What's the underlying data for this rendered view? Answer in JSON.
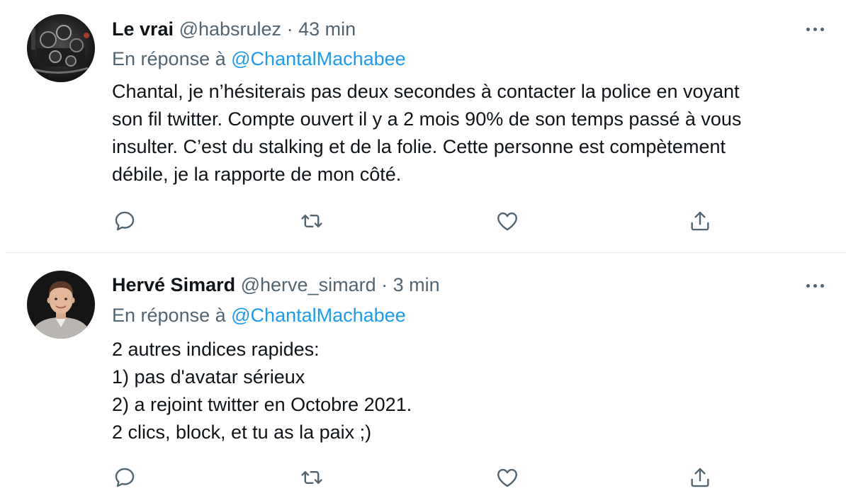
{
  "tweets": [
    {
      "name": "Le vrai",
      "handle": "@habsrulez",
      "separator": "·",
      "time": "43 min",
      "reply_prefix": "En réponse à",
      "reply_mention": "@ChantalMachabee",
      "body_lines": [
        "Chantal, je n’hésiterais pas deux secondes à contacter la police en voyant",
        "son fil twitter. Compte ouvert il y a 2 mois 90% de son temps passé à vous",
        "insulter. C’est du stalking et de la folie. Cette personne est compètement",
        "débile, je la rapporte de mon côté."
      ]
    },
    {
      "name": "Hervé Simard",
      "handle": "@herve_simard",
      "separator": "·",
      "time": "3 min",
      "reply_prefix": "En réponse à",
      "reply_mention": "@ChantalMachabee",
      "body_lines": [
        "2 autres indices rapides:",
        "1) pas d'avatar sérieux",
        "2) a rejoint twitter en Octobre 2021.",
        "2 clics, block, et tu as la paix ;)"
      ]
    }
  ],
  "icons": {
    "reply": "reply-icon",
    "retweet": "retweet-icon",
    "like": "heart-icon",
    "share": "share-icon",
    "more": "more-icon"
  },
  "colors": {
    "text": "#0f1419",
    "secondary": "#536471",
    "mention": "#1d9bf0",
    "divider": "#e6ecf0"
  }
}
